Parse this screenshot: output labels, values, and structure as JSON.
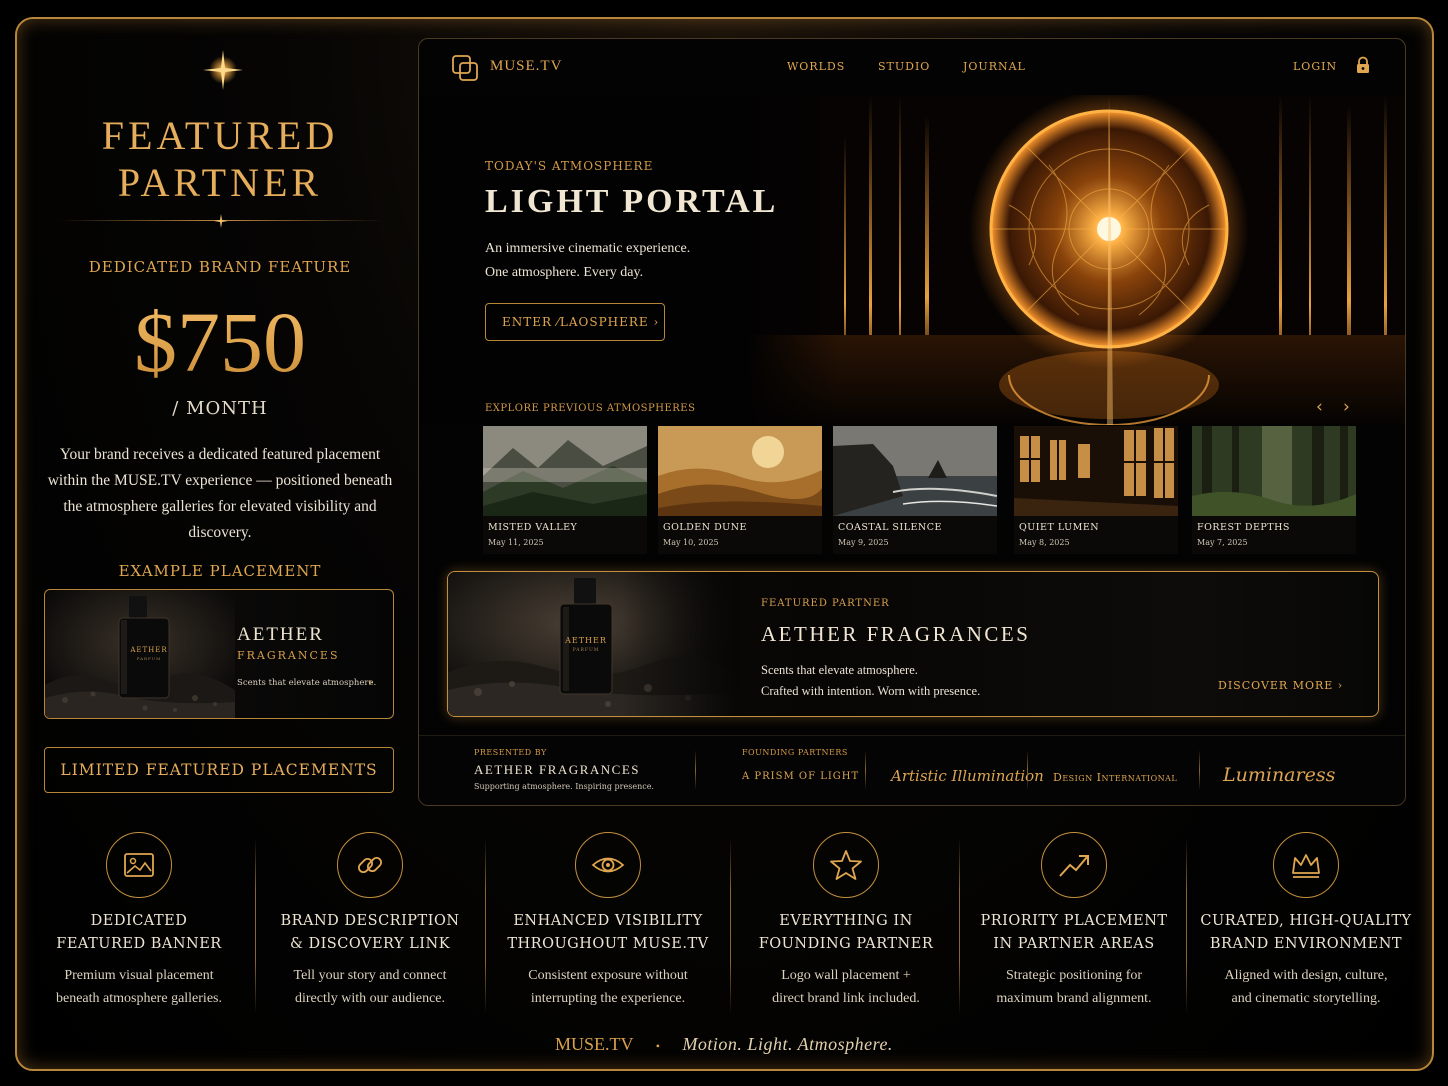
{
  "left": {
    "title_line1": "FEATURED",
    "title_line2": "PARTNER",
    "dedicated": "DEDICATED BRAND FEATURE",
    "price": "$750",
    "period": "/ MONTH",
    "description": "Your brand receives a dedicated featured placement within the MUSE.TV experience — positioned beneath the atmosphere galleries for elevated visibility and discovery.",
    "example_label": "EXAMPLE PLACEMENT",
    "example_card": {
      "bottle_text": "AETHER",
      "bottle_sub": "PARFUM",
      "name": "AETHER",
      "sub": "FRAGRANCES",
      "tagline": "Scents that elevate atmosphere.",
      "chevron": "›"
    },
    "limited_button": "LIMITED FEATURED PLACEMENTS"
  },
  "nav": {
    "logo": "MUSE.TV",
    "links": [
      "WORLDS",
      "STUDIO",
      "JOURNAL"
    ],
    "login": "LOGIN",
    "lock_icon": "lock-icon"
  },
  "hero": {
    "eyebrow": "TODAY'S ATMOSPHERE",
    "title": "LIGHT PORTAL",
    "desc_line1": "An immersive cinematic experience.",
    "desc_line2": "One atmosphere. Every day.",
    "button": "ENTER ⁄LAOSPHERE  ›"
  },
  "gallery": {
    "label": "EXPLORE PREVIOUS ATMOSPHERES",
    "prev": "‹",
    "next": "›",
    "items": [
      {
        "name": "MISTED VALLEY",
        "date": "May 11, 2025"
      },
      {
        "name": "GOLDEN DUNE",
        "date": "May 10, 2025"
      },
      {
        "name": "COASTAL SILENCE",
        "date": "May 9, 2025"
      },
      {
        "name": "QUIET LUMEN",
        "date": "May 8, 2025"
      },
      {
        "name": "FOREST DEPTHS",
        "date": "May 7, 2025"
      }
    ]
  },
  "banner": {
    "bottle_text": "AETHER",
    "bottle_sub": "PARFUM",
    "eyebrow": "FEATURED PARTNER",
    "title": "AETHER FRAGRANCES",
    "desc_line1": "Scents that elevate atmosphere.",
    "desc_line2": "Crafted with intention. Worn with presence.",
    "link": "DISCOVER MORE   ›"
  },
  "partners": {
    "presented_by": "PRESENTED BY",
    "presenter": "AETHER FRAGRANCES",
    "presenter_tag": "Supporting atmosphere. Inspiring presence.",
    "founding_label": "FOUNDING PARTNERS",
    "founding": [
      "A PRISM OF LIGHT",
      "Artistic Illumination",
      "Design International",
      "Luminaress"
    ]
  },
  "features": [
    {
      "icon": "image-icon",
      "title_line1": "DEDICATED",
      "title_line2": "FEATURED BANNER",
      "desc_line1": "Premium visual placement",
      "desc_line2": "beneath atmosphere galleries."
    },
    {
      "icon": "link-icon",
      "title_line1": "BRAND DESCRIPTION",
      "title_line2": "& DISCOVERY LINK",
      "desc_line1": "Tell your story and connect",
      "desc_line2": "directly with our audience."
    },
    {
      "icon": "eye-icon",
      "title_line1": "ENHANCED VISIBILITY",
      "title_line2": "THROUGHOUT MUSE.TV",
      "desc_line1": "Consistent exposure without",
      "desc_line2": "interrupting the experience."
    },
    {
      "icon": "star-icon",
      "title_line1": "EVERYTHING IN",
      "title_line2": "FOUNDING PARTNER",
      "desc_line1": "Logo wall placement +",
      "desc_line2": "direct brand link included."
    },
    {
      "icon": "trend-up-icon",
      "title_line1": "PRIORITY PLACEMENT",
      "title_line2": "IN PARTNER AREAS",
      "desc_line1": "Strategic positioning for",
      "desc_line2": "maximum brand alignment."
    },
    {
      "icon": "crown-icon",
      "title_line1": "CURATED, HIGH-QUALITY",
      "title_line2": "BRAND ENVIRONMENT",
      "desc_line1": "Aligned with design, culture,",
      "desc_line2": "and cinematic storytelling."
    }
  ],
  "footer": {
    "brand": "MUSE.TV",
    "separator": "•",
    "tagline": "Motion. Light. Atmosphere."
  },
  "colors": {
    "accent_gold": "#e0a650",
    "border_gold": "#b8863b",
    "background": "#000000"
  }
}
